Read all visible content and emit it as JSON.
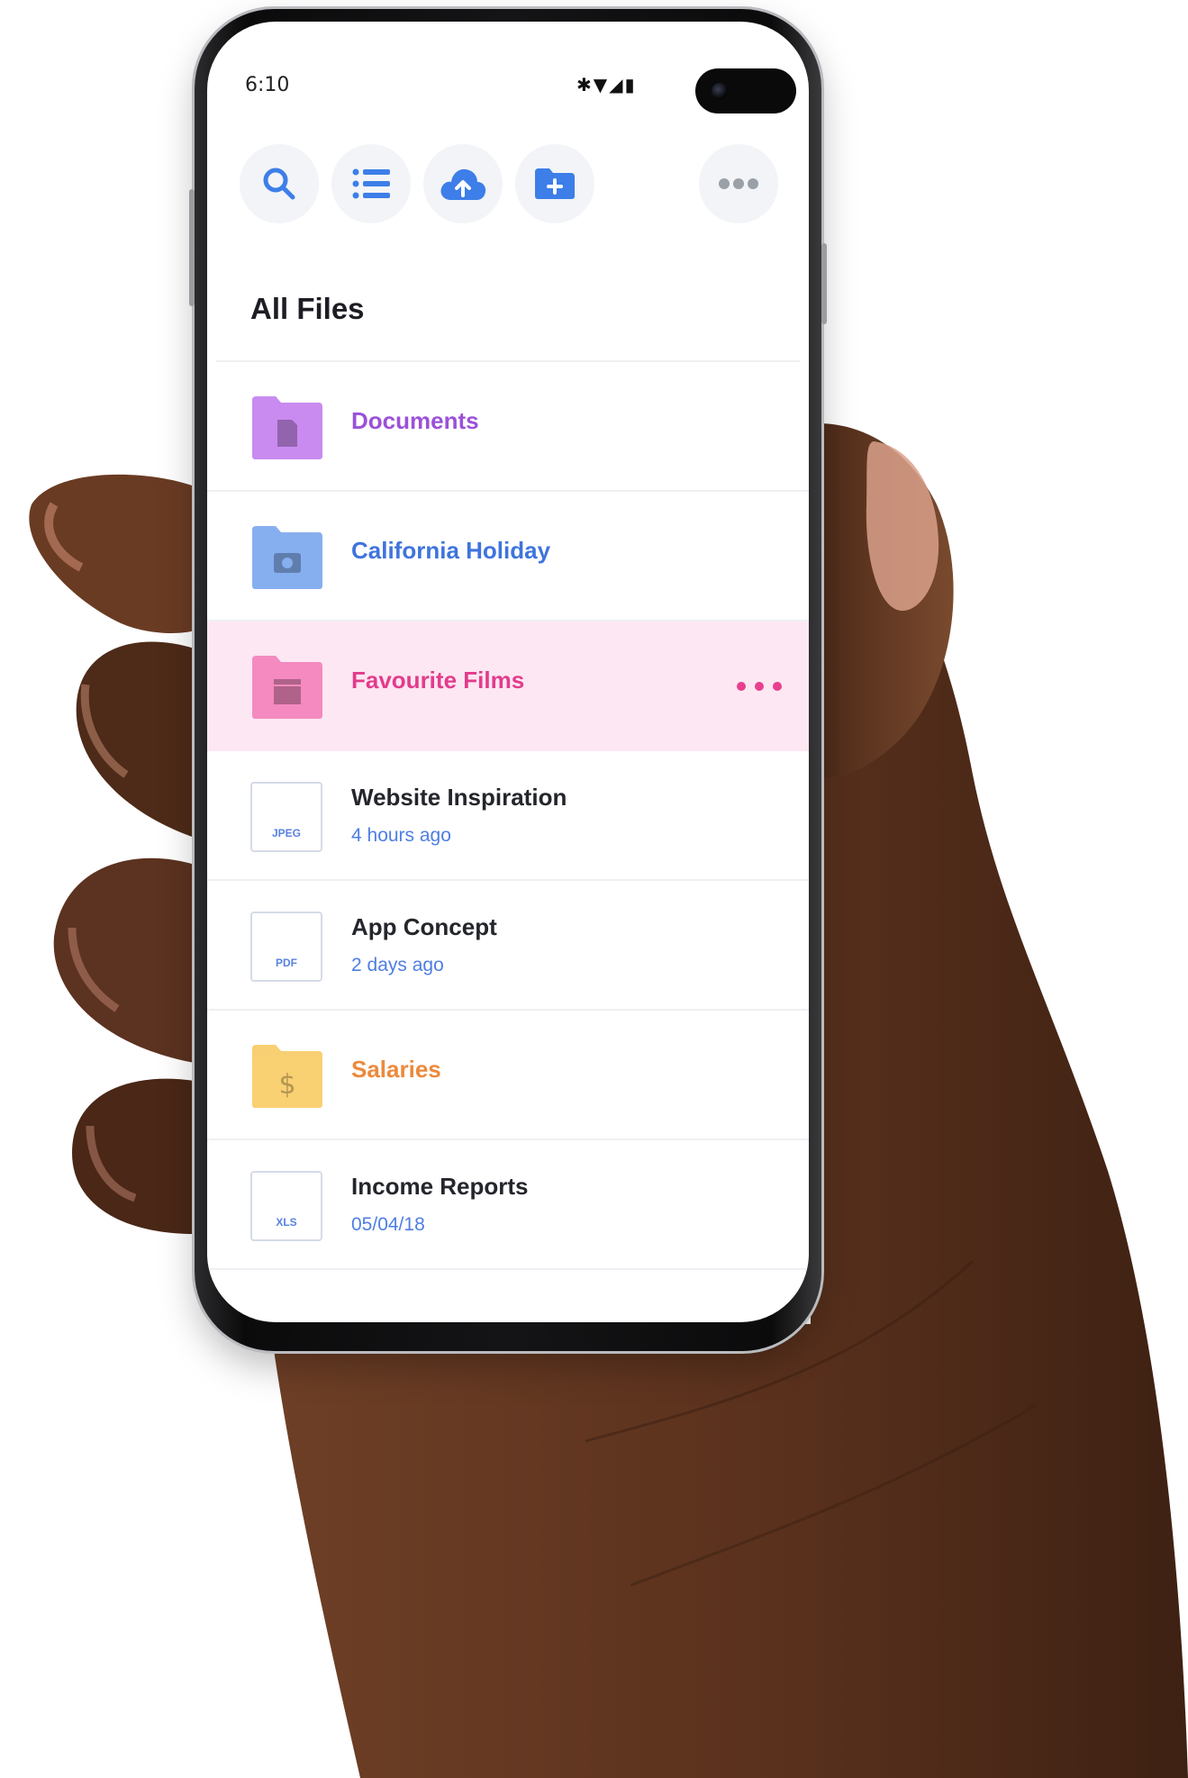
{
  "status_bar": {
    "time": "6:10",
    "icons_glyphs": "✱▼◢▮",
    "icons": [
      "bluetooth-icon",
      "wifi-icon",
      "signal-icon",
      "battery-icon"
    ]
  },
  "toolbar": {
    "buttons": [
      "search-icon",
      "list-view-icon",
      "cloud-upload-icon",
      "new-folder-icon",
      "more-options-icon"
    ],
    "accent": "#3d7ee8"
  },
  "section_title": "All Files",
  "items": [
    {
      "type": "folder",
      "name": "Documents",
      "color": "#9b51d8",
      "folder_color": "#c98bf0",
      "icon": "document-icon"
    },
    {
      "type": "folder",
      "name": "California Holiday",
      "color": "#3f74dd",
      "folder_color": "#86afef",
      "icon": "camera-icon"
    },
    {
      "type": "folder",
      "name": "Favourite Films",
      "color": "#e23c8c",
      "folder_color": "#f48ac0",
      "icon": "clapperboard-icon",
      "selected": true
    },
    {
      "type": "file",
      "name": "Website Inspiration",
      "subtitle": "4 hours ago",
      "ext": "JPEG"
    },
    {
      "type": "file",
      "name": "App Concept",
      "subtitle": "2 days ago",
      "ext": "PDF"
    },
    {
      "type": "folder",
      "name": "Salaries",
      "color": "#ec8a3c",
      "folder_color": "#f8cf72",
      "icon": "dollar-icon",
      "glyph": "$"
    },
    {
      "type": "file",
      "name": "Income Reports",
      "subtitle": "05/04/18",
      "ext": "XLS"
    }
  ]
}
